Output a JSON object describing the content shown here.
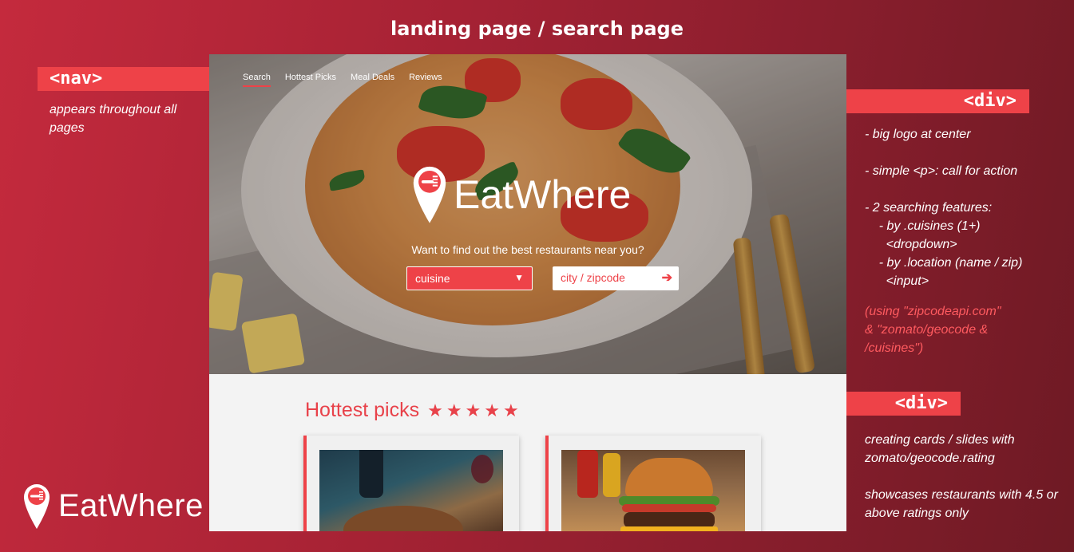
{
  "header": {
    "title": "landing page / search page"
  },
  "annotations": {
    "nav_tag": "<nav>",
    "nav_note": "appears throughout all pages",
    "div_tag_1": "<div>",
    "div_notes": [
      "- big logo at center",
      "",
      "- simple <p>: call for action",
      "",
      "- 2 searching features:",
      "    - by .cuisines (1+)",
      "      <dropdown>",
      "    - by .location (name / zip)",
      "      <input>"
    ],
    "api_note": [
      "(using \"zipcodeapi.com\"",
      "& \"zomato/geocode &",
      "/cuisines\")"
    ],
    "div_tag_2": "<div>",
    "cards_note_1": "creating cards / slides with zomato/geocode.rating",
    "cards_note_2": "showcases restaurants with 4.5 or above ratings only"
  },
  "brand": {
    "name": "EatWhere"
  },
  "mockup": {
    "nav": [
      "Search",
      "Hottest Picks",
      "Meal Deals",
      "Reviews"
    ],
    "active_nav": "Search",
    "logo_text": "EatWhere",
    "cta": "Want to find out the best restaurants near you?",
    "cuisine_select": {
      "value": "cuisine",
      "arrow": "▼"
    },
    "location_input": {
      "placeholder": "city / zipcode",
      "go_arrow": "➔"
    },
    "section_title": "Hottest picks",
    "stars": "★★★★★",
    "rating_stars": 5
  },
  "colors": {
    "accent": "#ee4248",
    "bg_start": "#c42a3d",
    "bg_end": "#6e1a24"
  },
  "icons": {
    "logo": "map-pin-fork-icon",
    "dropdown": "triangle-down-icon",
    "go": "arrow-right-icon"
  }
}
